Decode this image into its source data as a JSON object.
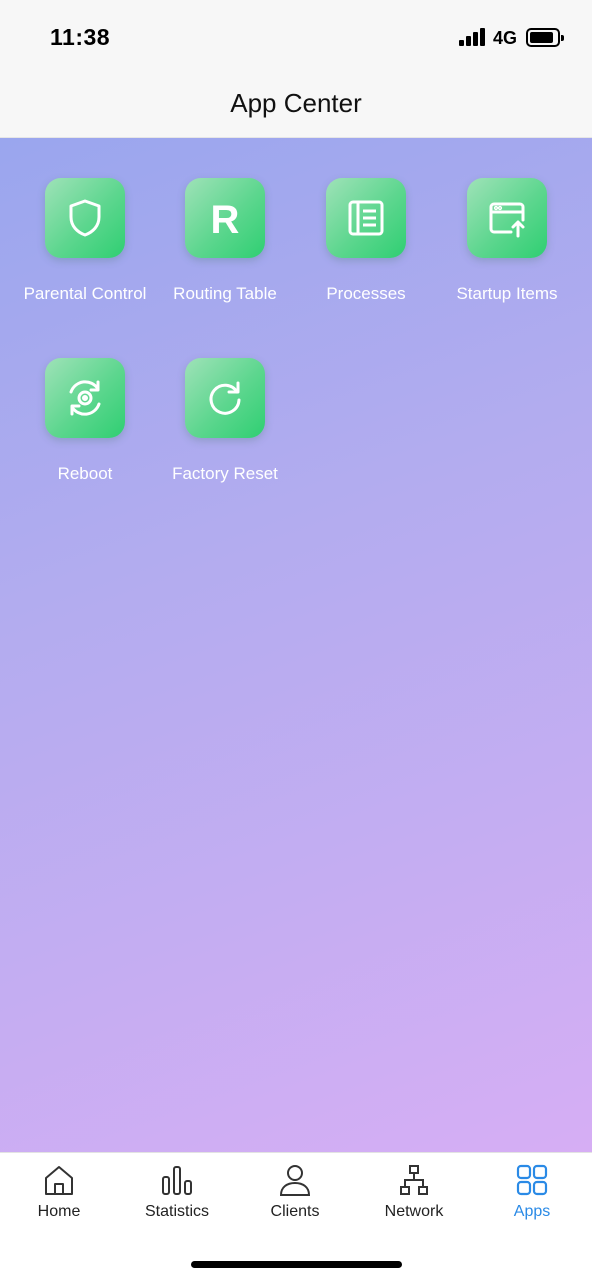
{
  "status": {
    "time": "11:38",
    "network": "4G",
    "battery_level": 0.9
  },
  "header": {
    "title": "App Center"
  },
  "apps": [
    {
      "label": "Parental Control",
      "icon": "shield-icon"
    },
    {
      "label": "Routing Table",
      "icon": "letter-r-icon"
    },
    {
      "label": "Processes",
      "icon": "list-icon"
    },
    {
      "label": "Startup Items",
      "icon": "window-upload-icon"
    },
    {
      "label": "Reboot",
      "icon": "reboot-icon"
    },
    {
      "label": "Factory Reset",
      "icon": "refresh-icon"
    }
  ],
  "tabs": [
    {
      "label": "Home",
      "icon": "home-icon"
    },
    {
      "label": "Statistics",
      "icon": "bar-chart-icon"
    },
    {
      "label": "Clients",
      "icon": "user-icon"
    },
    {
      "label": "Network",
      "icon": "network-icon"
    },
    {
      "label": "Apps",
      "icon": "grid-icon",
      "active": true
    }
  ],
  "colors": {
    "accent": "#2a8ae6",
    "icon_green": "#3ed27a",
    "gradient_start": "#9aa6ee",
    "gradient_end": "#d6aef4"
  }
}
